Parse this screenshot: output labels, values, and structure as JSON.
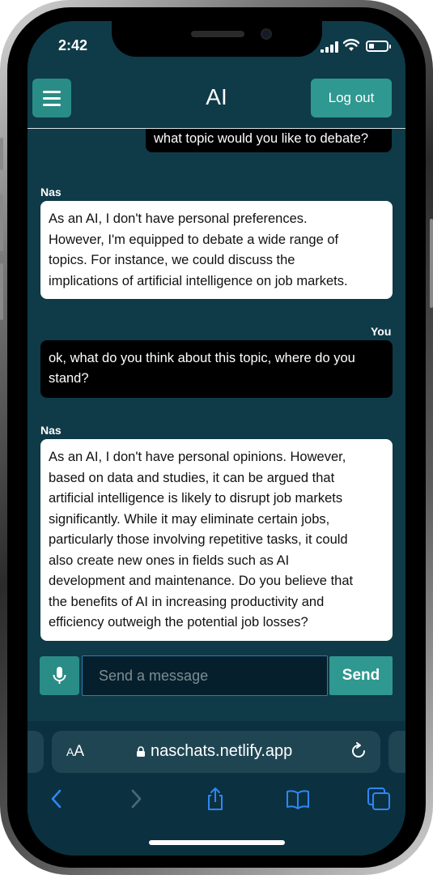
{
  "status_bar": {
    "time": "2:42"
  },
  "header": {
    "title": "AI",
    "logout_label": "Log out"
  },
  "messages": [
    {
      "sender": "",
      "text": "what topic would you like to debate?",
      "role": "user"
    },
    {
      "sender": "Nas",
      "lines": [
        "As an AI, I don't have personal preferences.",
        "However, I'm equipped to debate a wide range of",
        "topics. For instance, we could discuss the",
        "implications of artificial intelligence on job markets."
      ],
      "role": "ai"
    },
    {
      "sender": "You",
      "lines": [
        "ok, what do you think about this topic, where do you",
        "stand?"
      ],
      "role": "user"
    },
    {
      "sender": "Nas",
      "lines": [
        "As an AI, I don't have personal opinions. However,",
        "based on data and studies, it can be argued that",
        "artificial intelligence is likely to disrupt job markets",
        "significantly. While it may eliminate certain jobs,",
        "particularly those involving repetitive tasks, it could",
        "also create new ones in fields such as AI",
        "development and maintenance. Do you believe that",
        "the benefits of AI in increasing productivity and",
        "efficiency outweigh the potential job losses?"
      ],
      "role": "ai"
    }
  ],
  "composer": {
    "placeholder": "Send a message",
    "value": "",
    "send_label": "Send"
  },
  "browser": {
    "text_size_label": "AA",
    "url": "naschats.netlify.app"
  },
  "icons": {
    "menu": "hamburger-icon",
    "mic": "microphone-icon",
    "signal": "cellular-signal-icon",
    "wifi": "wifi-icon",
    "battery": "battery-icon",
    "lock": "lock-icon",
    "reload": "reload-icon",
    "back": "chevron-left-icon",
    "forward": "chevron-right-icon",
    "share": "share-icon",
    "bookmarks": "book-icon",
    "tabs": "tabs-icon"
  },
  "colors": {
    "background": "#0f3a48",
    "accent": "#2f9890",
    "user_bubble": "#000000",
    "ai_bubble": "#ffffff",
    "safari_blue": "#2f86f6"
  }
}
